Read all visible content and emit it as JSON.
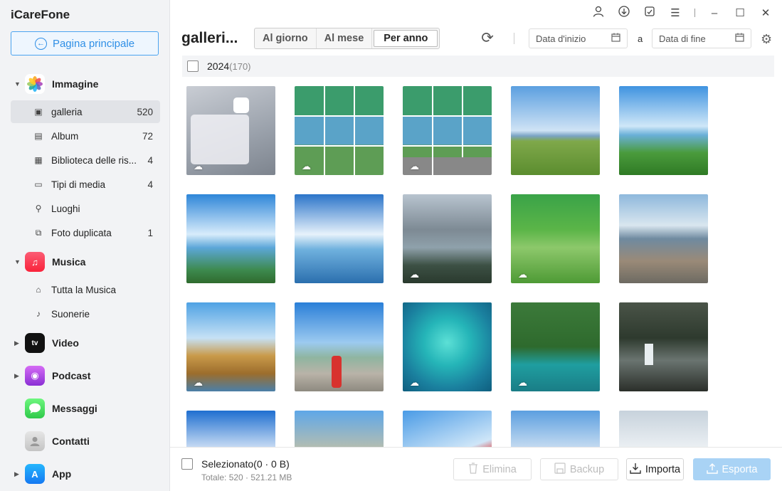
{
  "app": {
    "title": "iCareFone"
  },
  "sidebar": {
    "home_label": "Pagina principale",
    "categories": [
      {
        "label": "Immagine",
        "icon": "photos-icon"
      },
      {
        "label": "Musica",
        "icon": "music-icon"
      },
      {
        "label": "Video",
        "icon": "appletv-icon"
      },
      {
        "label": "Podcast",
        "icon": "podcast-icon"
      },
      {
        "label": "Messaggi",
        "icon": "messages-icon"
      },
      {
        "label": "Contatti",
        "icon": "contacts-icon"
      },
      {
        "label": "App",
        "icon": "appstore-icon"
      }
    ],
    "image_items": [
      {
        "label": "galleria",
        "count": "520",
        "icon": "gallery-icon"
      },
      {
        "label": "Album",
        "count": "72",
        "icon": "album-icon"
      },
      {
        "label": "Biblioteca delle ris...",
        "count": "4",
        "icon": "library-icon"
      },
      {
        "label": "Tipi di media",
        "count": "4",
        "icon": "media-types-icon"
      },
      {
        "label": "Luoghi",
        "count": "",
        "icon": "places-icon"
      },
      {
        "label": "Foto duplicata",
        "count": "1",
        "icon": "duplicate-icon"
      }
    ],
    "music_items": [
      {
        "label": "Tutta la Musica",
        "icon": "all-music-icon"
      },
      {
        "label": "Suonerie",
        "icon": "ringtone-icon"
      }
    ]
  },
  "header": {
    "title": "galleri...",
    "tabs": [
      {
        "label": "Al giorno"
      },
      {
        "label": "Al mese"
      },
      {
        "label": "Per anno"
      }
    ],
    "active_tab": "Per anno",
    "start_date_placeholder": "Data d'inizio",
    "to_label": "a",
    "end_date_placeholder": "Data di fine"
  },
  "content": {
    "group_label": "2024",
    "group_count": "(170)"
  },
  "footer": {
    "selected_label": "Selezionato(0 · 0 B)",
    "total_label": "Totale: 520 · 521.21 MB",
    "buttons": {
      "delete": "Elimina",
      "backup": "Backup",
      "import": "Importa",
      "export": "Esporta"
    }
  }
}
